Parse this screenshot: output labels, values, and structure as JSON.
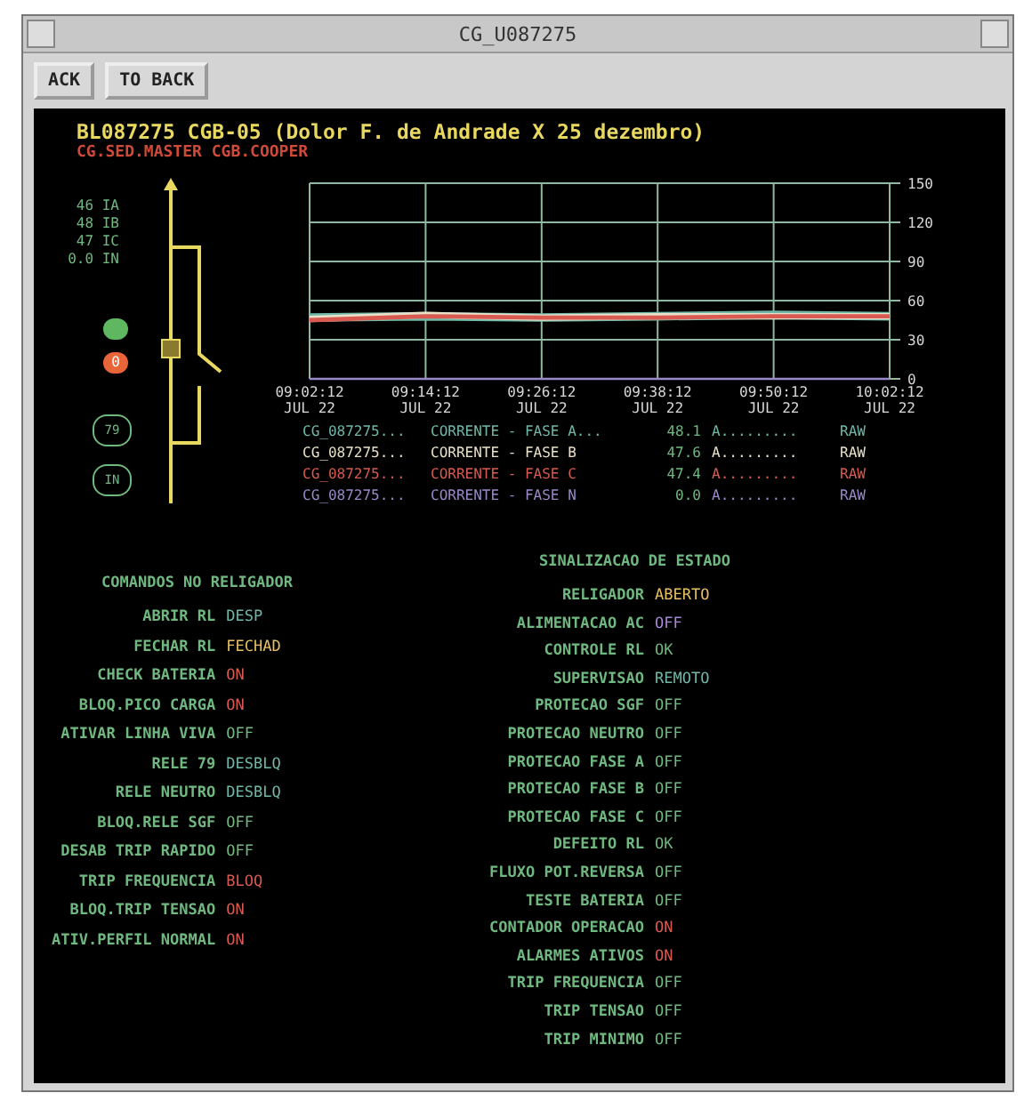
{
  "window": {
    "title": "CG_U087275"
  },
  "toolbar": {
    "buttons": [
      "ACK",
      "TO BACK"
    ]
  },
  "header": {
    "title": "BL087275 CGB-05 (Dolor F. de Andrade X 25 dezembro)",
    "subtitle": "CG.SED.MASTER CGB.COOPER"
  },
  "diagram": {
    "readings": [
      "46 IA",
      "48 IB",
      "47 IC",
      "0.0 IN"
    ],
    "indicators": [
      {
        "color": "#5fb85f"
      },
      {
        "label": "0",
        "color": "#e8653a"
      }
    ],
    "badges": [
      "79",
      "IN"
    ]
  },
  "chart": {
    "chart_data": {
      "type": "line",
      "x": [
        "09:02:12 JUL 22",
        "09:14:12 JUL 22",
        "09:26:12 JUL 22",
        "09:38:12 JUL 22",
        "09:50:12 JUL 22",
        "10:02:12 JUL 22"
      ],
      "ylim": [
        0,
        150
      ],
      "yticks": [
        0,
        30,
        60,
        90,
        120,
        150
      ],
      "grid": true,
      "series": [
        {
          "color": "#6fb8a8",
          "values": [
            47,
            48,
            47,
            48,
            49,
            48
          ]
        },
        {
          "color": "#e8e0c8",
          "values": [
            46,
            49,
            47,
            48,
            48,
            48
          ]
        },
        {
          "color": "#d85a50",
          "values": [
            45,
            48,
            47,
            47,
            48,
            48
          ]
        },
        {
          "color": "#9a88c8",
          "values": [
            0,
            0,
            0,
            0,
            0,
            0
          ]
        }
      ]
    },
    "legend": [
      {
        "point": "CG_087275...",
        "name": "CORRENTE - FASE A...",
        "value": "48.1",
        "unit": "A.........",
        "quality": "RAW",
        "color": "#6fb8a8"
      },
      {
        "point": "CG_087275...",
        "name": "CORRENTE - FASE B",
        "value": "47.6",
        "unit": "A.........",
        "quality": "RAW",
        "color": "#e8e0c8"
      },
      {
        "point": "CG_087275...",
        "name": "CORRENTE - FASE C",
        "value": "47.4",
        "unit": "A.........",
        "quality": "RAW",
        "color": "#d85a50"
      },
      {
        "point": "CG_087275...",
        "name": "CORRENTE - FASE N",
        "value": "0.0",
        "unit": "A.........",
        "quality": "RAW",
        "color": "#9a88c8"
      }
    ]
  },
  "commands": {
    "title": "COMANDOS NO RELIGADOR",
    "items": [
      {
        "label": "ABRIR RL",
        "value": "DESP",
        "color": "#6fb8a8"
      },
      {
        "label": "FECHAR RL",
        "value": "FECHAD",
        "color": "#e8c060"
      },
      {
        "label": "CHECK BATERIA",
        "value": "ON",
        "color": "#d85a50"
      },
      {
        "label": "BLOQ.PICO CARGA",
        "value": "ON",
        "color": "#d85a50"
      },
      {
        "label": "ATIVAR LINHA VIVA",
        "value": "OFF",
        "color": "#6fb880"
      },
      {
        "label": "RELE 79",
        "value": "DESBLQ",
        "color": "#6fb8a8"
      },
      {
        "label": "RELE NEUTRO",
        "value": "DESBLQ",
        "color": "#6fb8a8"
      },
      {
        "label": "BLOQ.RELE SGF",
        "value": "OFF",
        "color": "#6fb880"
      },
      {
        "label": "DESAB TRIP RAPIDO",
        "value": "OFF",
        "color": "#6fb880"
      },
      {
        "label": "TRIP FREQUENCIA",
        "value": "BLOQ",
        "color": "#d85a50"
      },
      {
        "label": "BLOQ.TRIP TENSAO",
        "value": "ON",
        "color": "#d85a50"
      },
      {
        "label": "ATIV.PERFIL NORMAL",
        "value": "ON",
        "color": "#d85a50"
      }
    ]
  },
  "status": {
    "title": "SINALIZACAO DE ESTADO",
    "items": [
      {
        "label": "RELIGADOR",
        "value": "ABERTO",
        "color": "#e8c060"
      },
      {
        "label": "ALIMENTACAO AC",
        "value": "OFF",
        "color": "#a888d8"
      },
      {
        "label": "CONTROLE RL",
        "value": "OK",
        "color": "#6fb880"
      },
      {
        "label": "SUPERVISAO",
        "value": "REMOTO",
        "color": "#6fb8a8"
      },
      {
        "label": "PROTECAO SGF",
        "value": "OFF",
        "color": "#6fb880"
      },
      {
        "label": "PROTECAO NEUTRO",
        "value": "OFF",
        "color": "#6fb880"
      },
      {
        "label": "PROTECAO FASE A",
        "value": "OFF",
        "color": "#6fb880"
      },
      {
        "label": "PROTECAO FASE B",
        "value": "OFF",
        "color": "#6fb880"
      },
      {
        "label": "PROTECAO FASE C",
        "value": "OFF",
        "color": "#6fb880"
      },
      {
        "label": "DEFEITO RL",
        "value": "OK",
        "color": "#6fb880"
      },
      {
        "label": "FLUXO POT.REVERSA",
        "value": "OFF",
        "color": "#6fb880"
      },
      {
        "label": "TESTE BATERIA",
        "value": "OFF",
        "color": "#6fb880"
      },
      {
        "label": "CONTADOR OPERACAO",
        "value": "ON",
        "color": "#d85a50"
      },
      {
        "label": "ALARMES ATIVOS",
        "value": "ON",
        "color": "#d85a50"
      },
      {
        "label": "TRIP FREQUENCIA",
        "value": "OFF",
        "color": "#6fb880"
      },
      {
        "label": "TRIP TENSAO",
        "value": "OFF",
        "color": "#6fb880"
      },
      {
        "label": "TRIP MINIMO",
        "value": "OFF",
        "color": "#6fb880"
      }
    ]
  }
}
